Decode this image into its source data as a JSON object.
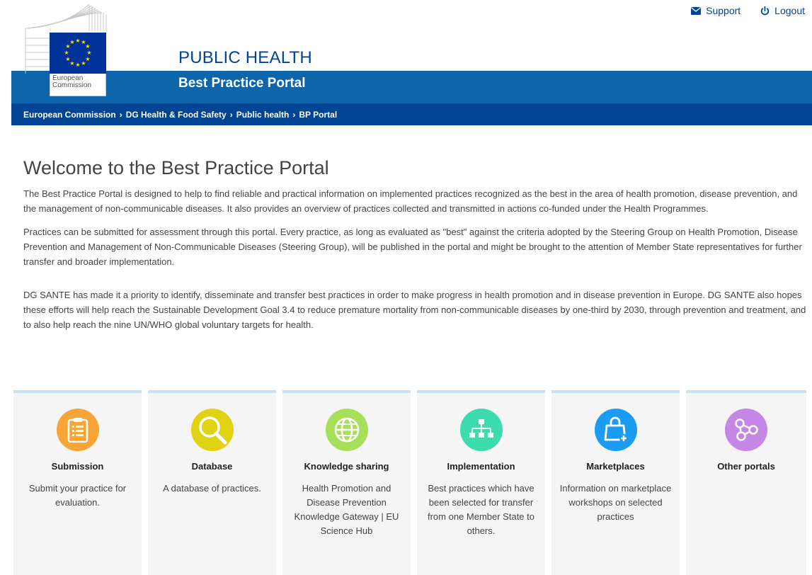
{
  "topbar": {
    "support_label": "Support",
    "logout_label": "Logout"
  },
  "logo": {
    "line1": "European",
    "line2": "Commission"
  },
  "header": {
    "title": "PUBLIC HEALTH",
    "subtitle": "Best Practice Portal"
  },
  "breadcrumb": {
    "items": [
      "European Commission",
      "DG Health & Food Safety",
      "Public health",
      "BP Portal"
    ],
    "separator": "›"
  },
  "main": {
    "title": "Welcome to the Best Practice Portal",
    "paragraphs": [
      "The Best Practice Portal is designed to help to find reliable and practical information on implemented practices recognized as the best in the area of health promotion, disease prevention, and the management of non-communicable diseases. It also provides an overview of practices collected and transmitted in actions co-funded under the Health Programmes.",
      "Practices can be submitted for assessment through this portal. Every practice, as long as evaluated as \"best\" against the criteria adopted by the Steering Group on Health Promotion, Disease Prevention and Management of Non-Communicable Diseases (Steering Group), will be published in the portal and might be brought to the attention of Member State representatives for further transfer and broader implementation.",
      "DG SANTE has made it a priority to identify, disseminate and transfer best practices in order to make progress in health promotion and in disease prevention in Europe. DG SANTE also hopes these efforts will help reach the Sustainable Development Goal 3.4 to reduce premature mortality from non-communicable diseases by one-third by 2030, through prevention and treatment, and to also help reach the nine UN/WHO global voluntary targets for health."
    ]
  },
  "cards": [
    {
      "title": "Submission",
      "desc": "Submit your practice for evaluation.",
      "icon": "clipboard-icon",
      "color": "#f7a536"
    },
    {
      "title": "Database",
      "desc": "A database of practices.",
      "icon": "magnifier-icon",
      "color": "#dfd314"
    },
    {
      "title": "Knowledge sharing",
      "desc": "Health Promotion and Disease Prevention Knowledge Gateway | EU Science Hub",
      "icon": "globe-icon",
      "color": "#a6e05a"
    },
    {
      "title": "Implementation",
      "desc": "Best practices which have been selected for transfer from one Member State to others.",
      "icon": "hierarchy-icon",
      "color": "#3ddcad"
    },
    {
      "title": "Marketplaces",
      "desc": "Information on marketplace workshops on selected practices",
      "icon": "shopping-bag-icon",
      "color": "#1b9cf0"
    },
    {
      "title": "Other portals",
      "desc": "",
      "icon": "share-nodes-icon",
      "color": "#c586e5"
    }
  ],
  "colors": {
    "brand_blue": "#004494",
    "band_blue": "#0e65a9",
    "card_top_border": "#cde0ef"
  }
}
